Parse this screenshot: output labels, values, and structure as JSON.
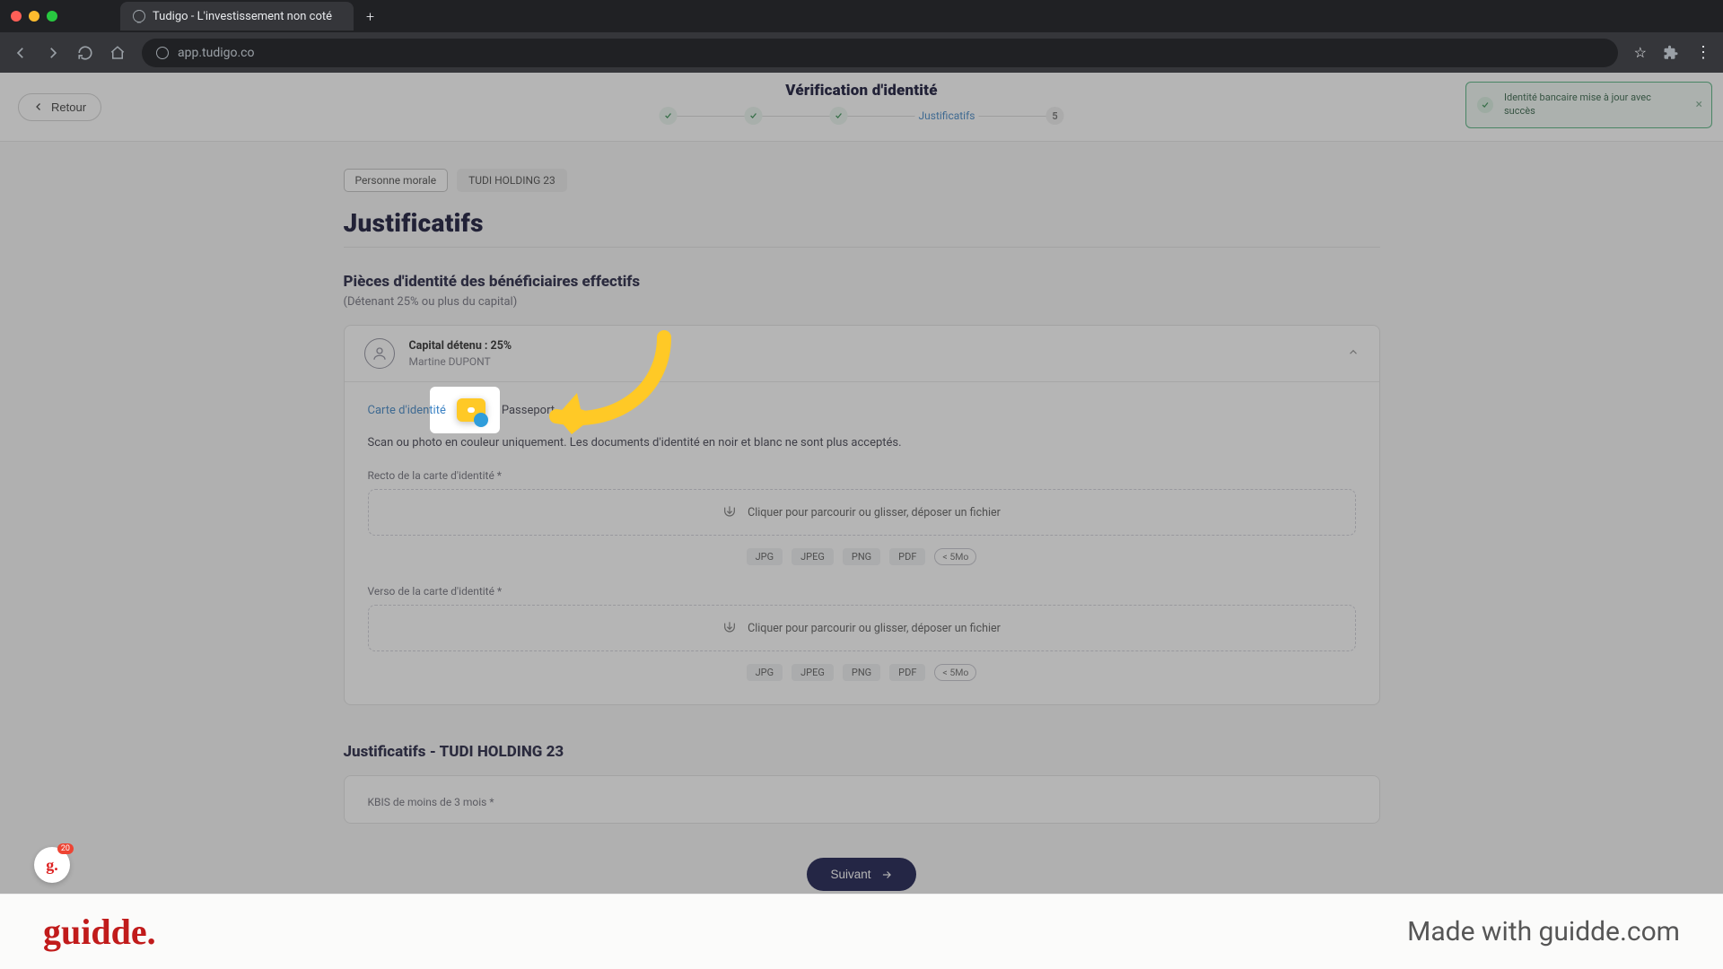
{
  "browser": {
    "tab_title": "Tudigo - L'investissement non coté",
    "url": "app.tudigo.co"
  },
  "topbar": {
    "back_label": "Retour",
    "page_title": "Vérification d'identité",
    "stepper": {
      "active_label": "Justificatifs",
      "pending_index": "5"
    },
    "toast": {
      "text": "Identité bancaire mise à jour avec succès"
    }
  },
  "badges": {
    "type": "Personne morale",
    "company": "TUDI HOLDING 23"
  },
  "h1": "Justificatifs",
  "section1": {
    "title": "Pièces d'identité des bénéficiaires effectifs",
    "subtitle": "(Détenant 25% ou plus du capital)"
  },
  "person": {
    "capital": "Capital détenu : 25%",
    "name": "Martine DUPONT"
  },
  "doctype": {
    "idcard": "Carte d'identité",
    "passport": "Passeport"
  },
  "hint": "Scan ou photo en couleur uniquement. Les documents d'identité en noir et blanc ne sont plus acceptés.",
  "fields": {
    "recto_label": "Recto de la carte d'identité *",
    "verso_label": "Verso de la carte d'identité *",
    "drop_text": "Cliquer pour parcourir ou glisser, déposer un fichier"
  },
  "formats": {
    "f1": "JPG",
    "f2": "JPEG",
    "f3": "PNG",
    "f4": "PDF",
    "size": "< 5Mo"
  },
  "section2": {
    "title": "Justificatifs - TUDI HOLDING 23",
    "kbis_label": "KBIS de moins de 3 mois *"
  },
  "next_button": "Suivant",
  "footer": {
    "logo": "guidde.",
    "tagline": "Made with guidde.com"
  },
  "guidde_badge": {
    "count": "20"
  }
}
